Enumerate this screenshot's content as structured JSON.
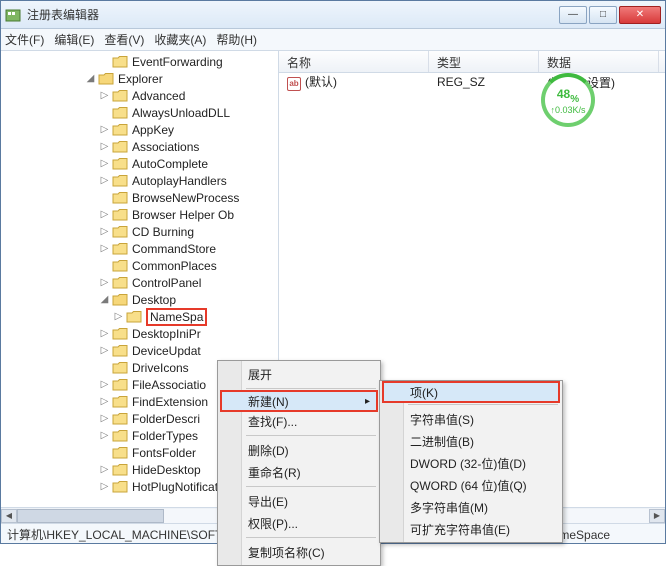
{
  "window": {
    "title": "注册表编辑器"
  },
  "win_buttons": {
    "min": "—",
    "max": "□",
    "close": "✕"
  },
  "speed": {
    "percent": "48",
    "percent_suffix": "%",
    "rate": "↑0.03K/s"
  },
  "menubar": {
    "file": "文件(F)",
    "edit": "编辑(E)",
    "view": "查看(V)",
    "favorites": "收藏夹(A)",
    "help": "帮助(H)"
  },
  "tree": {
    "items": [
      {
        "indent": 7,
        "toggle": "",
        "label": "EventForwarding"
      },
      {
        "indent": 6,
        "toggle": "◢",
        "label": "Explorer",
        "open": true
      },
      {
        "indent": 7,
        "toggle": "▷",
        "label": "Advanced"
      },
      {
        "indent": 7,
        "toggle": "",
        "label": "AlwaysUnloadDLL"
      },
      {
        "indent": 7,
        "toggle": "▷",
        "label": "AppKey"
      },
      {
        "indent": 7,
        "toggle": "▷",
        "label": "Associations"
      },
      {
        "indent": 7,
        "toggle": "▷",
        "label": "AutoComplete"
      },
      {
        "indent": 7,
        "toggle": "▷",
        "label": "AutoplayHandlers"
      },
      {
        "indent": 7,
        "toggle": "",
        "label": "BrowseNewProcess"
      },
      {
        "indent": 7,
        "toggle": "▷",
        "label": "Browser Helper Ob"
      },
      {
        "indent": 7,
        "toggle": "▷",
        "label": "CD Burning"
      },
      {
        "indent": 7,
        "toggle": "▷",
        "label": "CommandStore"
      },
      {
        "indent": 7,
        "toggle": "",
        "label": "CommonPlaces"
      },
      {
        "indent": 7,
        "toggle": "▷",
        "label": "ControlPanel"
      },
      {
        "indent": 7,
        "toggle": "◢",
        "label": "Desktop",
        "open": true
      },
      {
        "indent": 8,
        "toggle": "▷",
        "label": "NameSpa",
        "highlight": true
      },
      {
        "indent": 7,
        "toggle": "▷",
        "label": "DesktopIniPr"
      },
      {
        "indent": 7,
        "toggle": "▷",
        "label": "DeviceUpdat"
      },
      {
        "indent": 7,
        "toggle": "",
        "label": "DriveIcons"
      },
      {
        "indent": 7,
        "toggle": "▷",
        "label": "FileAssociatio"
      },
      {
        "indent": 7,
        "toggle": "▷",
        "label": "FindExtension"
      },
      {
        "indent": 7,
        "toggle": "▷",
        "label": "FolderDescri"
      },
      {
        "indent": 7,
        "toggle": "▷",
        "label": "FolderTypes"
      },
      {
        "indent": 7,
        "toggle": "",
        "label": "FontsFolder"
      },
      {
        "indent": 7,
        "toggle": "▷",
        "label": "HideDesktop"
      },
      {
        "indent": 7,
        "toggle": "▷",
        "label": "HotPlugNotification"
      }
    ]
  },
  "list": {
    "columns": {
      "name": "名称",
      "type": "类型",
      "data": "数据"
    },
    "widths": {
      "name": 150,
      "type": 110,
      "data": 120
    },
    "rows": [
      {
        "name": "(默认)",
        "type": "REG_SZ",
        "data": "(数值未设置)"
      }
    ]
  },
  "ab_icon_text": "ab",
  "ctx1": {
    "expand": "展开",
    "new": "新建(N)",
    "find": "查找(F)...",
    "delete": "删除(D)",
    "rename": "重命名(R)",
    "export": "导出(E)",
    "perm": "权限(P)...",
    "copyname": "复制项名称(C)"
  },
  "ctx2": {
    "key": "项(K)",
    "string": "字符串值(S)",
    "binary": "二进制值(B)",
    "dword": "DWORD (32-位)值(D)",
    "qword": "QWORD (64 位)值(Q)",
    "multi": "多字符串值(M)",
    "expand": "可扩充字符串值(E)"
  },
  "statusbar": "计算机\\HKEY_LOCAL_MACHINE\\SOFTWARE\\Microsoft\\Windows\\CurrentVersion\\Explorer\\Desktop\\NameSpace",
  "arrow": "▸"
}
